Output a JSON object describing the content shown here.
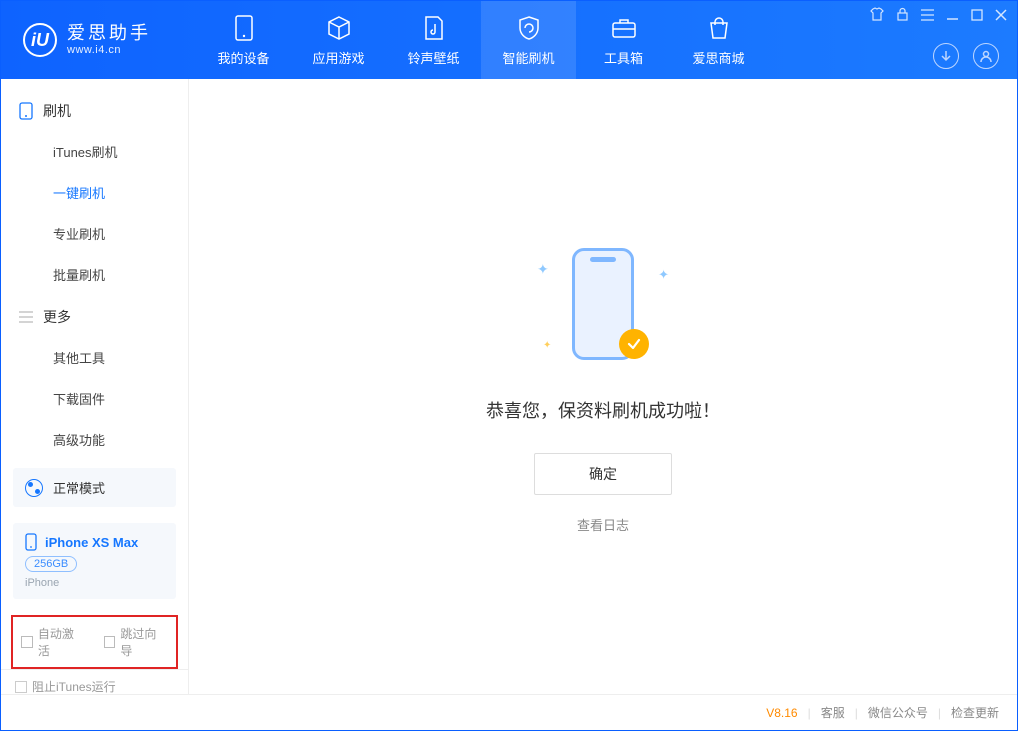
{
  "app": {
    "title": "爱思助手",
    "subtitle": "www.i4.cn"
  },
  "tabs": {
    "my_device": "我的设备",
    "apps_games": "应用游戏",
    "ringtones": "铃声壁纸",
    "smart_flash": "智能刷机",
    "toolbox": "工具箱",
    "store": "爱思商城"
  },
  "sidebar": {
    "flash_section": "刷机",
    "items_flash": [
      "iTunes刷机",
      "一键刷机",
      "专业刷机",
      "批量刷机"
    ],
    "more_section": "更多",
    "items_more": [
      "其他工具",
      "下载固件",
      "高级功能"
    ]
  },
  "mode": {
    "label": "正常模式"
  },
  "device": {
    "name": "iPhone XS Max",
    "capacity": "256GB",
    "type": "iPhone"
  },
  "options": {
    "auto_activate": "自动激活",
    "skip_guide": "跳过向导"
  },
  "main": {
    "success_message": "恭喜您，保资料刷机成功啦！",
    "ok_button": "确定",
    "view_log": "查看日志"
  },
  "footer": {
    "block_itunes": "阻止iTunes运行",
    "version": "V8.16",
    "support": "客服",
    "wechat": "微信公众号",
    "check_update": "检查更新"
  }
}
